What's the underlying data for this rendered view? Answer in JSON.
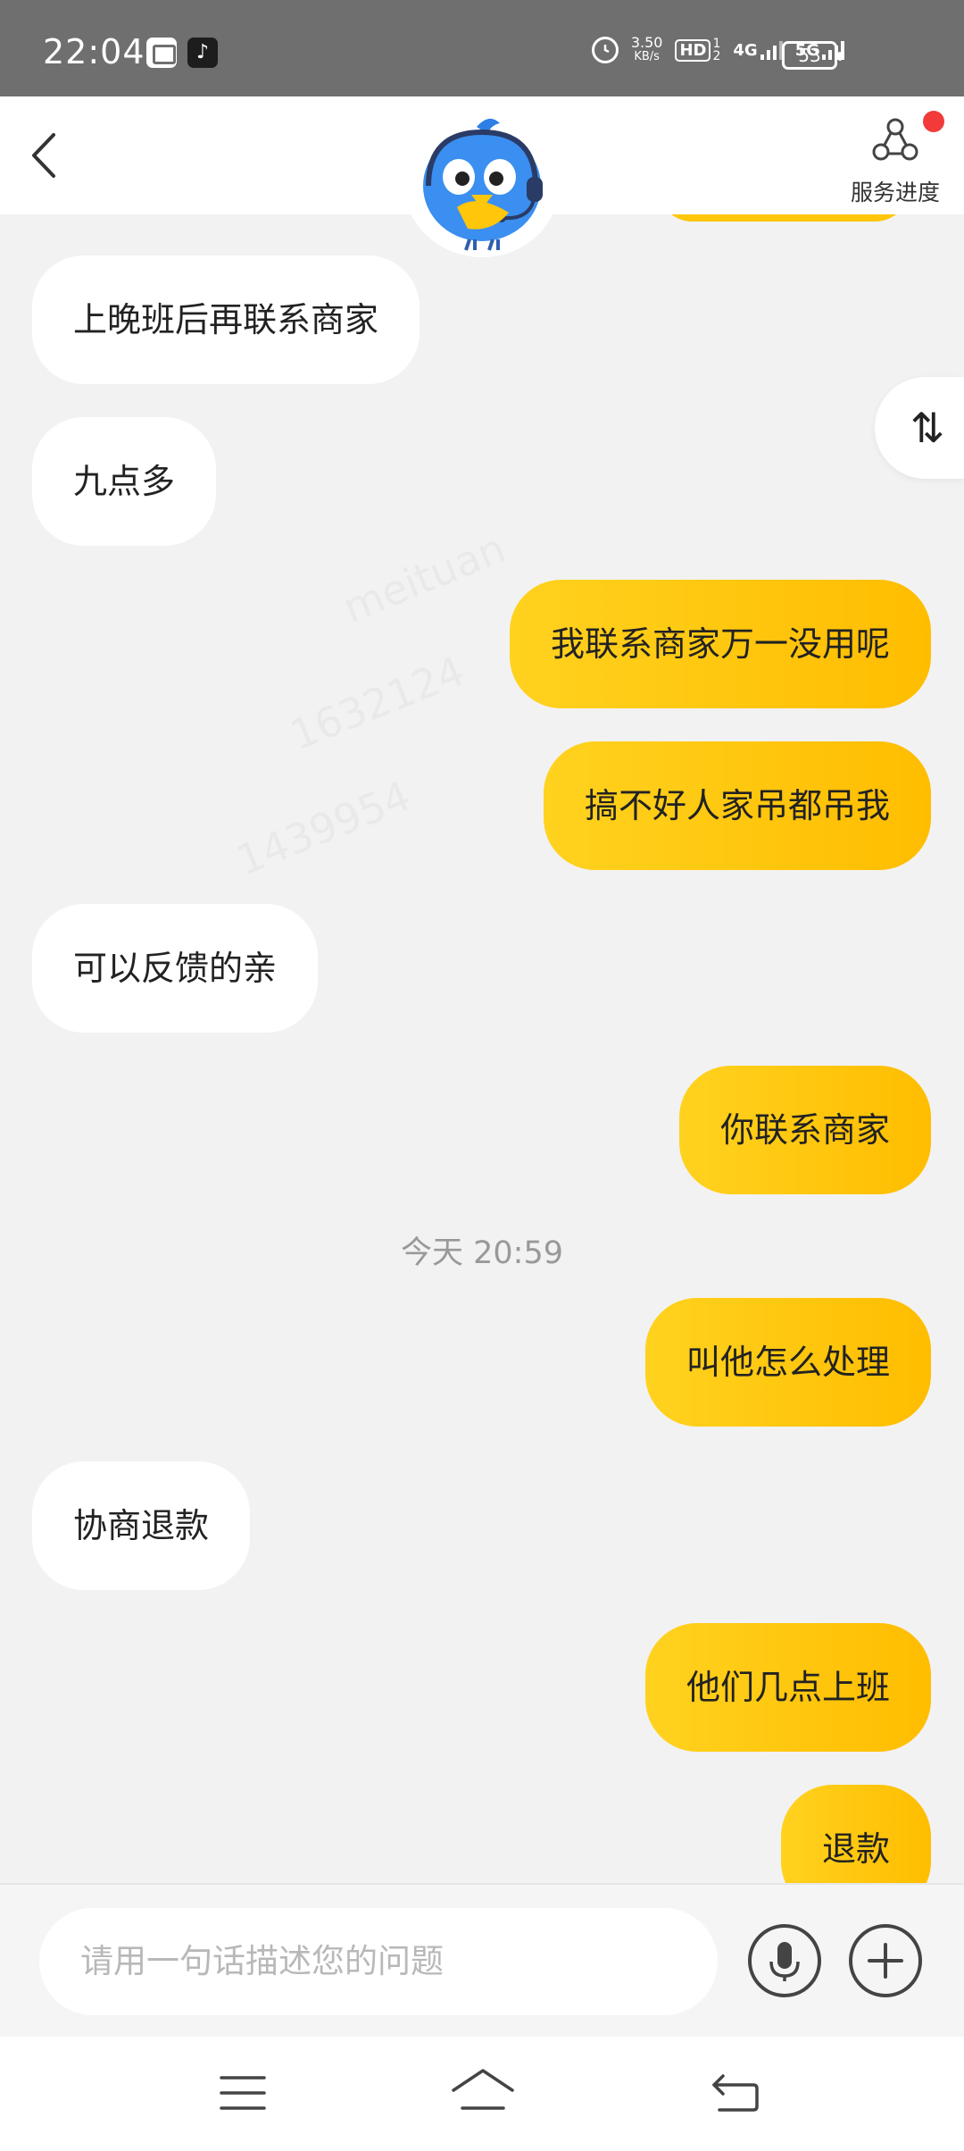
{
  "status_bar": {
    "time": "22:04",
    "net_speed_value": "3.50",
    "net_speed_unit": "KB/s",
    "hd": "HD",
    "hd_sub_top": "1",
    "hd_sub_bottom": "2",
    "network_4g": "4G",
    "network_5g": "5G",
    "battery": "53"
  },
  "header": {
    "service_progress_label": "服务进度"
  },
  "messages": [
    {
      "side": "left",
      "text": "上晚班后再联系商家"
    },
    {
      "side": "left",
      "text": "九点多"
    },
    {
      "side": "right",
      "text": "我联系商家万一没用呢"
    },
    {
      "side": "right",
      "text": "搞不好人家吊都吊我"
    },
    {
      "side": "left",
      "text": "可以反馈的亲"
    },
    {
      "side": "right",
      "text": "你联系商家"
    },
    {
      "side": "right",
      "text": "叫他怎么处理"
    },
    {
      "side": "left",
      "text": "协商退款"
    },
    {
      "side": "right",
      "text": "他们几点上班"
    },
    {
      "side": "right",
      "text": "退款"
    }
  ],
  "timestamp": "今天 20:59",
  "scroll_toggle_glyph": "⇅",
  "input": {
    "placeholder": "请用一句话描述您的问题"
  },
  "colors": {
    "accent_yellow": "#ffc60a",
    "status_bar_bg": "#6f6f6f",
    "chat_bg": "#f2f2f2",
    "notification_dot": "#f23a3a"
  }
}
